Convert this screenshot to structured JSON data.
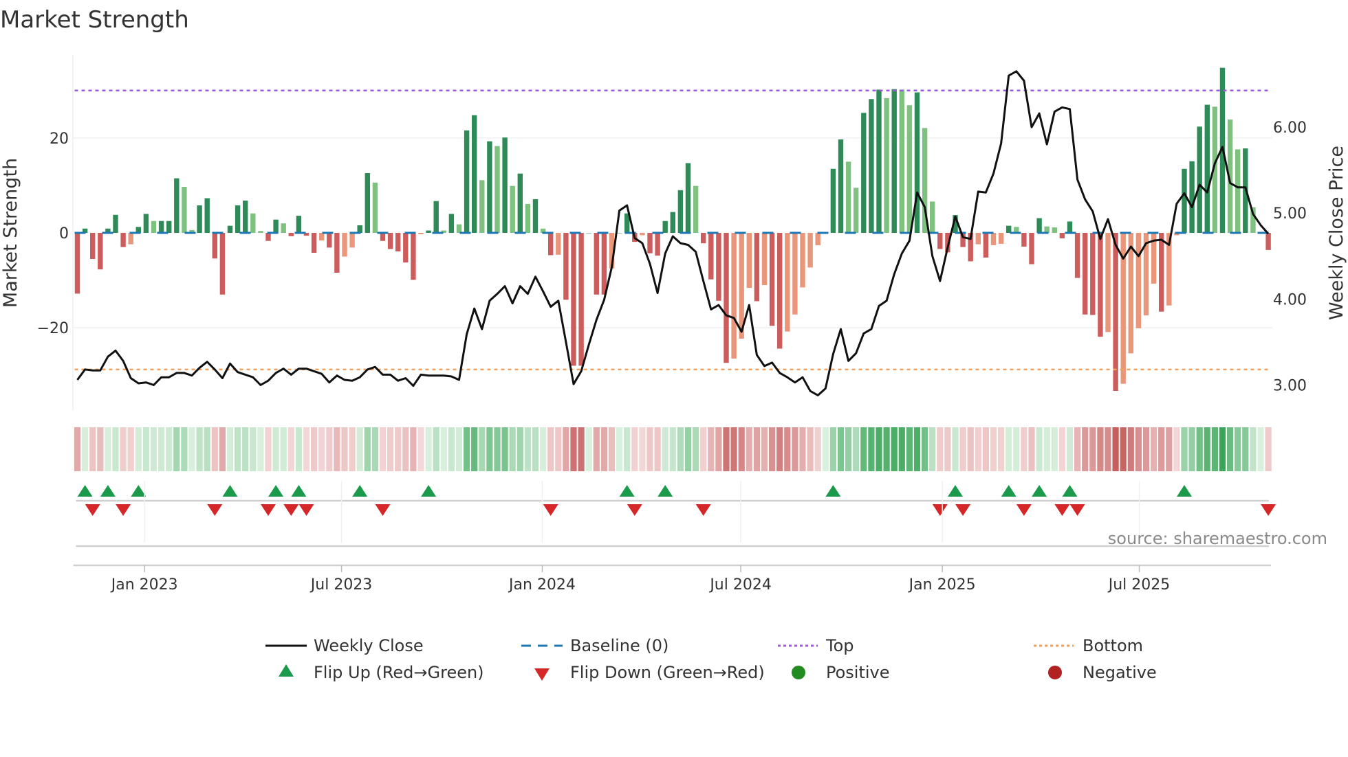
{
  "title": "Market Strength",
  "source": "source: sharemaestro.com",
  "legend": {
    "weekly_close": "Weekly Close",
    "baseline": "Baseline (0)",
    "top": "Top",
    "bottom": "Bottom",
    "flip_up": "Flip Up (Red→Green)",
    "flip_down": "Flip Down (Green→Red)",
    "positive": "Positive",
    "negative": "Negative"
  },
  "colors": {
    "strong_up": "#2e8b57",
    "weak_up": "#7fc27f",
    "strong_down": "#cd5c5c",
    "weak_down": "#e9967a",
    "baseline": "#1f77b4",
    "top": "#9b59e0",
    "bottom": "#f0a060",
    "close": "#111111",
    "flip_up": "#1a9a4a",
    "flip_down": "#d62728",
    "positive": "#228b22",
    "negative": "#b22222"
  },
  "chart_data": {
    "type": "bar+line",
    "title": "Market Strength",
    "ylabel": "Market Strength",
    "y2label": "Weekly Close Price",
    "ylim": [
      -37.5,
      37.5
    ],
    "y2lim": [
      2.7,
      6.84
    ],
    "yticks": [
      {
        "v": 20,
        "label": "20"
      },
      {
        "v": 0,
        "label": "0"
      },
      {
        "v": -20,
        "label": "−20"
      }
    ],
    "y2ticks": [
      {
        "v": 6,
        "label": "6.00"
      },
      {
        "v": 5,
        "label": "5.00"
      },
      {
        "v": 4,
        "label": "4.00"
      },
      {
        "v": 3,
        "label": "3.00"
      }
    ],
    "xticks": [
      {
        "week": 8.8,
        "label": "Jan 2023"
      },
      {
        "week": 34.6,
        "label": "Jul 2023"
      },
      {
        "week": 60.9,
        "label": "Jan 2024"
      },
      {
        "week": 86.9,
        "label": "Jul 2024"
      },
      {
        "week": 113.3,
        "label": "Jan 2025"
      },
      {
        "week": 139.1,
        "label": "Jul 2025"
      }
    ],
    "top_level": 30,
    "bottom_level": -28.8,
    "strength": [
      -12.8,
      0.9,
      -5.5,
      -7.7,
      0.9,
      3.8,
      -3.0,
      -2.4,
      1.25,
      4.0,
      2.5,
      2.5,
      2.5,
      11.5,
      9.7,
      0.6,
      5.8,
      7.3,
      -5.4,
      -13.0,
      1.5,
      5.8,
      6.8,
      4.1,
      0.4,
      -1.7,
      2.8,
      2.0,
      -0.7,
      3.6,
      -0.6,
      -4.2,
      -1.6,
      -3.1,
      -8.4,
      -5.0,
      -3.1,
      1.6,
      12.6,
      10.6,
      -1.7,
      -3.4,
      -3.9,
      -6.25,
      -9.9,
      -0.3,
      0.5,
      6.7,
      0.5,
      4.0,
      1.8,
      21.6,
      24.8,
      11.1,
      19.3,
      18.3,
      20.1,
      9.9,
      12.5,
      6.1,
      7.1,
      0.9,
      -4.7,
      -4.6,
      -14.1,
      -28.0,
      -28.0,
      0,
      -13.0,
      -13.0,
      -7.5,
      0,
      4.1,
      -1.9,
      -0.5,
      -4.3,
      -4.8,
      2.5,
      4.4,
      9.0,
      14.7,
      9.9,
      -2.2,
      -9.8,
      -14.3,
      -27.4,
      -26.5,
      -22.3,
      -11.6,
      -14.4,
      -11.0,
      -19.6,
      -24.4,
      -20.8,
      -17.2,
      -11.5,
      -7.3,
      -2.6,
      0,
      13.5,
      19.7,
      15.0,
      9.5,
      25.3,
      28.2,
      30.2,
      28.4,
      30.3,
      30.2,
      26.9,
      29.6,
      22.1,
      6.6,
      -3.4,
      -4.1,
      3.75,
      -3.0,
      -6.0,
      -2.4,
      -5.2,
      -2.6,
      -2.3,
      1.5,
      1.25,
      -2.9,
      -6.6,
      3.1,
      1.35,
      1.15,
      -1.15,
      2.4,
      -9.5,
      -17.2,
      -17.3,
      -21.9,
      -20.9,
      -33.3,
      -31.8,
      -25.4,
      -20.1,
      -17.4,
      -10.7,
      -16.6,
      -15.3,
      -0.5,
      13.5,
      15.1,
      22.4,
      27.0,
      26.6,
      34.8,
      23.9,
      17.6,
      17.8,
      5.4,
      0.1,
      -3.6
    ],
    "weekly_close": [
      3.06,
      3.18,
      3.17,
      3.17,
      3.33,
      3.4,
      3.28,
      3.08,
      3.02,
      3.03,
      3.0,
      3.09,
      3.09,
      3.14,
      3.14,
      3.11,
      3.2,
      3.27,
      3.18,
      3.08,
      3.25,
      3.15,
      3.12,
      3.09,
      3.0,
      3.05,
      3.14,
      3.19,
      3.12,
      3.19,
      3.19,
      3.16,
      3.13,
      3.03,
      3.11,
      3.06,
      3.05,
      3.09,
      3.18,
      3.21,
      3.12,
      3.12,
      3.05,
      3.08,
      2.99,
      3.12,
      3.11,
      3.11,
      3.11,
      3.1,
      3.06,
      3.59,
      3.89,
      3.65,
      3.98,
      4.06,
      4.15,
      3.95,
      4.15,
      4.06,
      4.26,
      4.09,
      3.91,
      3.98,
      3.5,
      3.01,
      3.16,
      3.47,
      3.76,
      3.99,
      4.37,
      5.03,
      5.09,
      4.71,
      4.65,
      4.41,
      4.07,
      4.53,
      4.73,
      4.65,
      4.63,
      4.55,
      4.21,
      3.88,
      3.93,
      3.81,
      3.78,
      3.62,
      3.93,
      3.35,
      3.22,
      3.26,
      3.14,
      3.09,
      3.03,
      3.09,
      2.93,
      2.88,
      2.96,
      3.36,
      3.65,
      3.28,
      3.37,
      3.6,
      3.65,
      3.92,
      3.98,
      4.29,
      4.53,
      4.68,
      5.24,
      5.07,
      4.5,
      4.21,
      4.6,
      4.96,
      4.72,
      4.7,
      5.25,
      5.24,
      5.46,
      5.81,
      6.6,
      6.65,
      6.54,
      6.0,
      6.16,
      5.8,
      6.18,
      6.23,
      6.21,
      5.39,
      5.16,
      5.02,
      4.7,
      4.93,
      4.63,
      4.47,
      4.61,
      4.5,
      4.65,
      4.68,
      4.69,
      4.63,
      5.11,
      5.23,
      5.07,
      5.33,
      5.24,
      5.58,
      5.77,
      5.35,
      5.3,
      5.3,
      4.99,
      4.86,
      4.76
    ]
  }
}
